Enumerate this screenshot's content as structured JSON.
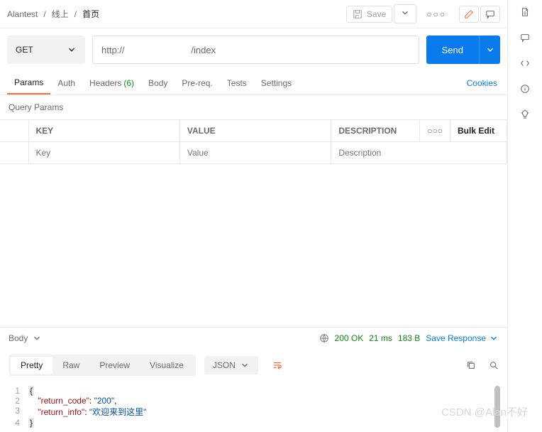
{
  "breadcrumb": {
    "root": "Alantest",
    "mid": "线上",
    "cur": "首页",
    "sep": "/"
  },
  "toolbar": {
    "save": "Save",
    "more": "○○○"
  },
  "request": {
    "method": "GET",
    "url": "http://                          /index",
    "send": "Send"
  },
  "tabs": {
    "params": "Params",
    "auth": "Auth",
    "headers": "Headers",
    "headers_count": "(6)",
    "body": "Body",
    "prereq": "Pre-req.",
    "tests": "Tests",
    "settings": "Settings",
    "cookies": "Cookies"
  },
  "qp": {
    "title": "Query Params",
    "key_h": "KEY",
    "val_h": "VALUE",
    "desc_h": "DESCRIPTION",
    "bulk": "Bulk Edit",
    "key_ph": "Key",
    "val_ph": "Value",
    "desc_ph": "Description"
  },
  "res": {
    "body": "Body",
    "status": "200 OK",
    "time": "21 ms",
    "size": "183 B",
    "save_resp": "Save Response"
  },
  "view": {
    "pretty": "Pretty",
    "raw": "Raw",
    "preview": "Preview",
    "visualize": "Visualize",
    "fmt": "JSON"
  },
  "code": {
    "l1": {
      "n": "1",
      "open": "{"
    },
    "l2": {
      "n": "2",
      "indent": "    ",
      "k": "\"return_code\"",
      "c": ": ",
      "v": "\"200\"",
      "t": ","
    },
    "l3": {
      "n": "3",
      "indent": "    ",
      "k": "\"return_info\"",
      "c": ": ",
      "v": "\"欢迎来到这里\""
    },
    "l4": {
      "n": "4",
      "close": "}"
    }
  },
  "watermark": "CSDN @Alan不好"
}
